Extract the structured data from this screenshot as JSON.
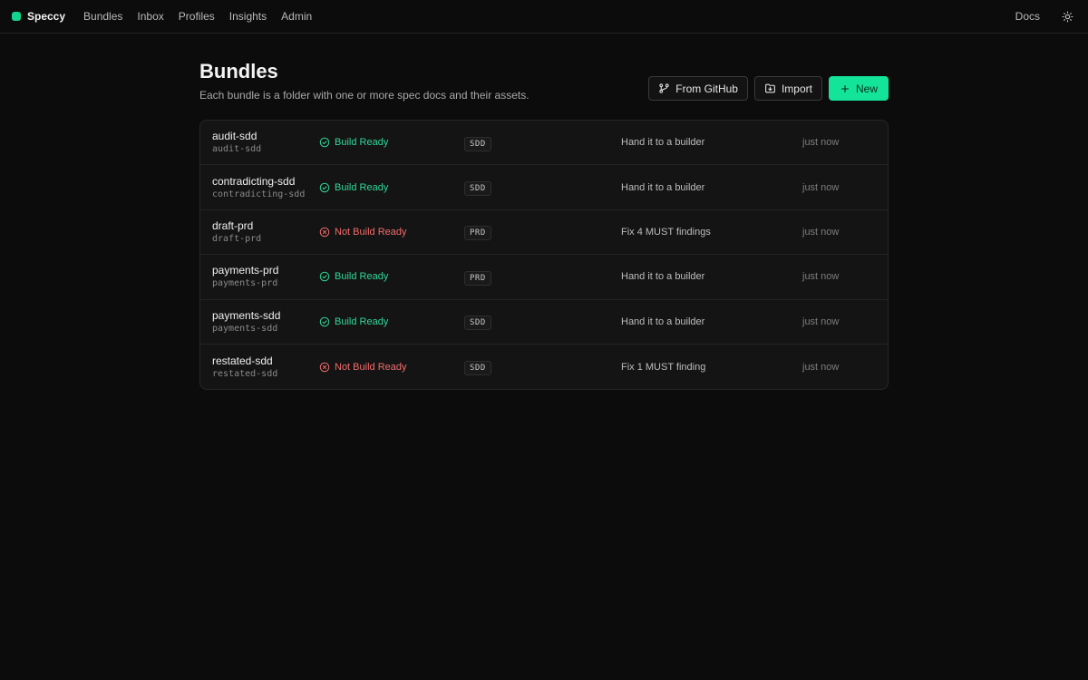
{
  "app": {
    "name": "Speccy",
    "nav": [
      "Bundles",
      "Inbox",
      "Profiles",
      "Insights",
      "Admin"
    ],
    "docs_label": "Docs",
    "brand_color": "#12d48e"
  },
  "page": {
    "title": "Bundles",
    "subtitle": "Each bundle is a folder with one or more spec docs and their assets.",
    "buttons": {
      "github": "From GitHub",
      "import": "Import",
      "new": "New"
    }
  },
  "bundles": [
    {
      "title": "audit-sdd",
      "slug": "audit-sdd",
      "status": "Build Ready",
      "ready": true,
      "type": "SDD",
      "next": "Hand it to a builder",
      "updated": "just now"
    },
    {
      "title": "contradicting-sdd",
      "slug": "contradicting-sdd",
      "status": "Build Ready",
      "ready": true,
      "type": "SDD",
      "next": "Hand it to a builder",
      "updated": "just now"
    },
    {
      "title": "draft-prd",
      "slug": "draft-prd",
      "status": "Not Build Ready",
      "ready": false,
      "type": "PRD",
      "next": "Fix 4 MUST findings",
      "updated": "just now"
    },
    {
      "title": "payments-prd",
      "slug": "payments-prd",
      "status": "Build Ready",
      "ready": true,
      "type": "PRD",
      "next": "Hand it to a builder",
      "updated": "just now"
    },
    {
      "title": "payments-sdd",
      "slug": "payments-sdd",
      "status": "Build Ready",
      "ready": true,
      "type": "SDD",
      "next": "Hand it to a builder",
      "updated": "just now"
    },
    {
      "title": "restated-sdd",
      "slug": "restated-sdd",
      "status": "Not Build Ready",
      "ready": false,
      "type": "SDD",
      "next": "Fix 1 MUST finding",
      "updated": "just now"
    }
  ],
  "colors": {
    "ready": "#2fd89a",
    "not_ready": "#f26c6c",
    "primary_button": "#13e49a"
  }
}
